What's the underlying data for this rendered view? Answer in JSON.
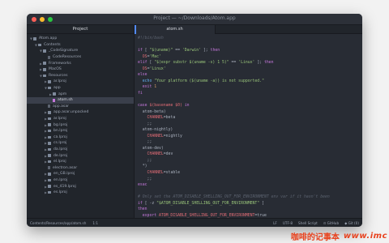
{
  "window": {
    "title": "Project — ~/Downloads/Atom.app",
    "traffic_colors": [
      "#ff5f57",
      "#febc2e",
      "#28c840"
    ]
  },
  "sidebar": {
    "header": "Project",
    "items": [
      {
        "label": "Atom.app",
        "depth": 0,
        "kind": "folder",
        "open": true
      },
      {
        "label": "Contents",
        "depth": 1,
        "kind": "folder",
        "open": true
      },
      {
        "label": "_CodeSignature",
        "depth": 2,
        "kind": "folder",
        "open": true
      },
      {
        "label": "CodeResources",
        "depth": 3,
        "kind": "file"
      },
      {
        "label": "Frameworks",
        "depth": 2,
        "kind": "folder",
        "open": false
      },
      {
        "label": "MacOS",
        "depth": 2,
        "kind": "folder",
        "open": false
      },
      {
        "label": "Resources",
        "depth": 2,
        "kind": "folder",
        "open": true
      },
      {
        "label": "ar.lproj",
        "depth": 3,
        "kind": "folder",
        "open": false
      },
      {
        "label": "app",
        "depth": 3,
        "kind": "folder",
        "open": true
      },
      {
        "label": "apm",
        "depth": 4,
        "kind": "folder",
        "open": false
      },
      {
        "label": "atom.sh",
        "depth": 4,
        "kind": "file-accent",
        "selected": true
      },
      {
        "label": "app.asar",
        "depth": 3,
        "kind": "file"
      },
      {
        "label": "app.asar.unpacked",
        "depth": 3,
        "kind": "folder",
        "open": false
      },
      {
        "label": "ar.lproj",
        "depth": 3,
        "kind": "folder",
        "open": false
      },
      {
        "label": "bg.lproj",
        "depth": 3,
        "kind": "folder",
        "open": false
      },
      {
        "label": "bn.lproj",
        "depth": 3,
        "kind": "folder",
        "open": false
      },
      {
        "label": "ca.lproj",
        "depth": 3,
        "kind": "folder",
        "open": false
      },
      {
        "label": "cs.lproj",
        "depth": 3,
        "kind": "folder",
        "open": false
      },
      {
        "label": "da.lproj",
        "depth": 3,
        "kind": "folder",
        "open": false
      },
      {
        "label": "de.lproj",
        "depth": 3,
        "kind": "folder",
        "open": false
      },
      {
        "label": "el.lproj",
        "depth": 3,
        "kind": "folder",
        "open": false
      },
      {
        "label": "electron.asar",
        "depth": 3,
        "kind": "file"
      },
      {
        "label": "en_GB.lproj",
        "depth": 3,
        "kind": "folder",
        "open": false
      },
      {
        "label": "en.lproj",
        "depth": 3,
        "kind": "folder",
        "open": false
      },
      {
        "label": "es_419.lproj",
        "depth": 3,
        "kind": "folder",
        "open": false
      },
      {
        "label": "es.lproj",
        "depth": 3,
        "kind": "folder",
        "open": false
      }
    ]
  },
  "editor": {
    "tab_label": "atom.sh",
    "lines": [
      [
        {
          "t": "#!/bin/bash",
          "c": "comment"
        }
      ],
      [],
      [
        {
          "t": "if",
          "c": "kw"
        },
        {
          "t": " [ ",
          "c": "plain"
        },
        {
          "t": "\"$(uname)\"",
          "c": "str"
        },
        {
          "t": " == ",
          "c": "plain"
        },
        {
          "t": "'Darwin'",
          "c": "str"
        },
        {
          "t": " ]; ",
          "c": "plain"
        },
        {
          "t": "then",
          "c": "kw"
        }
      ],
      [
        {
          "t": "  OS",
          "c": "var"
        },
        {
          "t": "=",
          "c": "plain"
        },
        {
          "t": "'Mac'",
          "c": "str"
        }
      ],
      [
        {
          "t": "elif",
          "c": "kw"
        },
        {
          "t": " [ ",
          "c": "plain"
        },
        {
          "t": "\"$(expr substr $(uname -s) 1 5)\"",
          "c": "str"
        },
        {
          "t": " == ",
          "c": "plain"
        },
        {
          "t": "'Linux'",
          "c": "str"
        },
        {
          "t": " ]; ",
          "c": "plain"
        },
        {
          "t": "then",
          "c": "kw"
        }
      ],
      [
        {
          "t": "  OS",
          "c": "var"
        },
        {
          "t": "=",
          "c": "plain"
        },
        {
          "t": "'Linux'",
          "c": "str"
        }
      ],
      [
        {
          "t": "else",
          "c": "kw"
        }
      ],
      [
        {
          "t": "  echo",
          "c": "fn"
        },
        {
          "t": " ",
          "c": "plain"
        },
        {
          "t": "\"Your platform ($(uname -a)) is not supported.\"",
          "c": "str"
        }
      ],
      [
        {
          "t": "  exit",
          "c": "kw"
        },
        {
          "t": " 1",
          "c": "num"
        }
      ],
      [
        {
          "t": "fi",
          "c": "kw"
        }
      ],
      [],
      [
        {
          "t": "case",
          "c": "kw"
        },
        {
          "t": " ",
          "c": "plain"
        },
        {
          "t": "$(basename $0)",
          "c": "var"
        },
        {
          "t": " ",
          "c": "plain"
        },
        {
          "t": "in",
          "c": "kw"
        }
      ],
      [
        {
          "t": "  atom-beta)",
          "c": "plain"
        }
      ],
      [
        {
          "t": "    CHANNEL",
          "c": "var"
        },
        {
          "t": "=beta",
          "c": "plain"
        }
      ],
      [
        {
          "t": "    ;;",
          "c": "plain"
        }
      ],
      [
        {
          "t": "  atom-nightly)",
          "c": "plain"
        }
      ],
      [
        {
          "t": "    CHANNEL",
          "c": "var"
        },
        {
          "t": "=nightly",
          "c": "plain"
        }
      ],
      [
        {
          "t": "    ;;",
          "c": "plain"
        }
      ],
      [
        {
          "t": "  atom-dev)",
          "c": "plain"
        }
      ],
      [
        {
          "t": "    CHANNEL",
          "c": "var"
        },
        {
          "t": "=dev",
          "c": "plain"
        }
      ],
      [
        {
          "t": "    ;;",
          "c": "plain"
        }
      ],
      [
        {
          "t": "  *)",
          "c": "plain"
        }
      ],
      [
        {
          "t": "    CHANNEL",
          "c": "var"
        },
        {
          "t": "=stable",
          "c": "plain"
        }
      ],
      [
        {
          "t": "    ;;",
          "c": "plain"
        }
      ],
      [
        {
          "t": "esac",
          "c": "kw"
        }
      ],
      [],
      [
        {
          "t": "# Only set the ATOM_DISABLE_SHELLING_OUT_FOR_ENVIRONMENT env var if it hasn't been",
          "c": "comment"
        }
      ],
      [
        {
          "t": "if",
          "c": "kw"
        },
        {
          "t": " [ -z ",
          "c": "plain"
        },
        {
          "t": "\"$ATOM_DISABLE_SHELLING_OUT_FOR_ENVIRONMENT\"",
          "c": "str"
        },
        {
          "t": " ]",
          "c": "plain"
        }
      ],
      [
        {
          "t": "then",
          "c": "kw"
        }
      ],
      [
        {
          "t": "  export",
          "c": "kw"
        },
        {
          "t": " ATOM_DISABLE_SHELLING_OUT_FOR_ENVIRONMENT",
          "c": "var"
        },
        {
          "t": "=true",
          "c": "plain"
        }
      ]
    ],
    "colors": {
      "comment": "#5c6370",
      "kw": "#c678dd",
      "str": "#98c379",
      "var": "#e06c75",
      "fn": "#61afef",
      "num": "#d19a66",
      "plain": "#abb2bf"
    }
  },
  "statusbar": {
    "path": "Contents/Resources/app/atom.sh",
    "cursor": "1:1",
    "line_ending": "LF",
    "encoding": "UTF-8",
    "grammar": "Shell Script",
    "github": "GitHub",
    "git": "Git (0)"
  },
  "watermark": {
    "text": "咖啡的记事本",
    "url": "www.imc"
  }
}
